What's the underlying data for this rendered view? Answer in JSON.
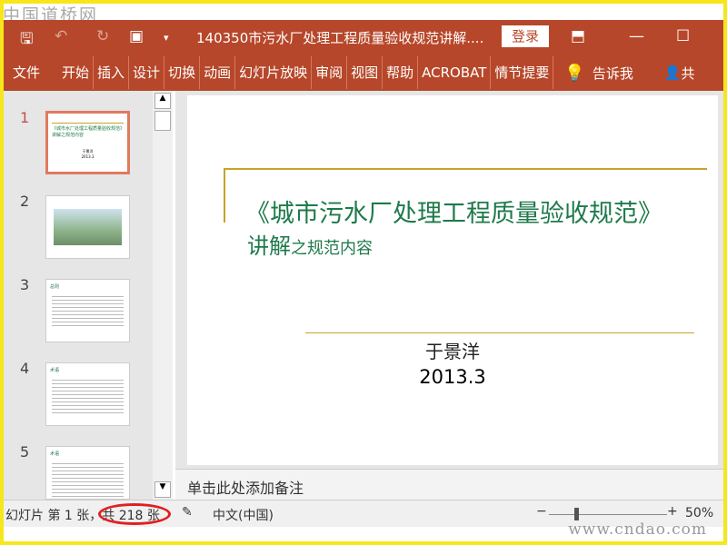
{
  "watermarks": {
    "top_left": "中国道桥网",
    "bottom_right": "www.cndao.com"
  },
  "titlebar": {
    "title": "140350市污水厂处理工程质量验收规范讲解....",
    "login": "登录"
  },
  "ribbon": {
    "tabs": [
      "文件",
      "开始",
      "插入",
      "设计",
      "切换",
      "动画",
      "幻灯片放映",
      "审阅",
      "视图",
      "帮助",
      "ACROBAT",
      "情节提要"
    ],
    "tell_me": "告诉我",
    "share": "共"
  },
  "thumbnails": [
    {
      "number": "1",
      "title": "《城市水厂处理工程质量验收规范》讲解之规范内容",
      "author": "于景洋",
      "date": "2013.3"
    },
    {
      "number": "2"
    },
    {
      "number": "3",
      "heading": "总则"
    },
    {
      "number": "4",
      "heading": "术语"
    },
    {
      "number": "5",
      "heading": "术语"
    }
  ],
  "slide": {
    "title_line1": "《城市污水厂处理工程质量验收规范》",
    "title_line2_big": "讲解",
    "title_line2_small": "之规范内容",
    "author": "于景洋",
    "date": "2013.3"
  },
  "notes": {
    "placeholder": "单击此处添加备注"
  },
  "status": {
    "slide_info": "幻灯片 第 1 张，共 218 张",
    "language": "中文(中国)",
    "zoom": "50%",
    "zoom_level_percent": 50
  },
  "colors": {
    "accent": "#b7472a",
    "frame": "#f7e61a",
    "title_green": "#1e7a4a",
    "rule_gold": "#c9a227"
  }
}
